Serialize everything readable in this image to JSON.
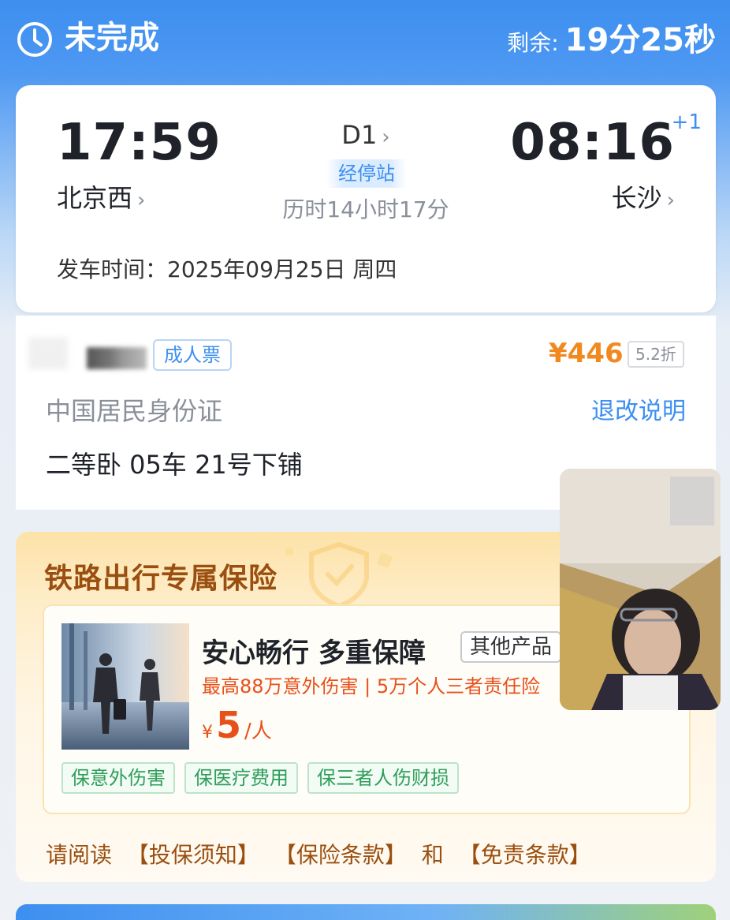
{
  "header": {
    "status": "未完成",
    "remaining_label": "剩余:",
    "remaining_time": "19分25秒"
  },
  "trip": {
    "departure_time": "17:59",
    "departure_station": "北京西",
    "train_number": "D1",
    "stops_label": "经停站",
    "duration": "历时14小时17分",
    "arrival_time": "08:16",
    "arrival_day_offset": "+1",
    "arrival_station": "长沙",
    "departure_date": "发车时间：2025年09月25日 周四"
  },
  "passenger": {
    "ticket_type": "成人票",
    "price": "¥446",
    "discount": "5.2折",
    "id_type": "中国居民身份证",
    "refund_link": "退改说明",
    "seat": "二等卧 05车 21号下铺"
  },
  "insurance": {
    "section_title": "铁路出行专属保险",
    "product_name": "安心畅行 多重保障",
    "other_products": "其他产品",
    "coverage": "最高88万意外伤害 | 5万个人三者责任险",
    "price_currency": "¥",
    "price_value": "5",
    "price_unit": "/人",
    "tags": [
      "保意外伤害",
      "保医疗费用",
      "保三者人伤财损"
    ],
    "terms_prefix": "请阅读",
    "terms_links": [
      "【投保须知】",
      "【保险条款】"
    ],
    "terms_and": "和",
    "terms_last": "【免责条款】"
  },
  "colors": {
    "brand_blue": "#3d8ff0",
    "price_orange": "#f08a20",
    "insurance_red": "#e8501a",
    "tag_green": "#2f9e5a"
  },
  "icons": {
    "status": "clock-icon",
    "chevron": "chevron-right-icon"
  }
}
